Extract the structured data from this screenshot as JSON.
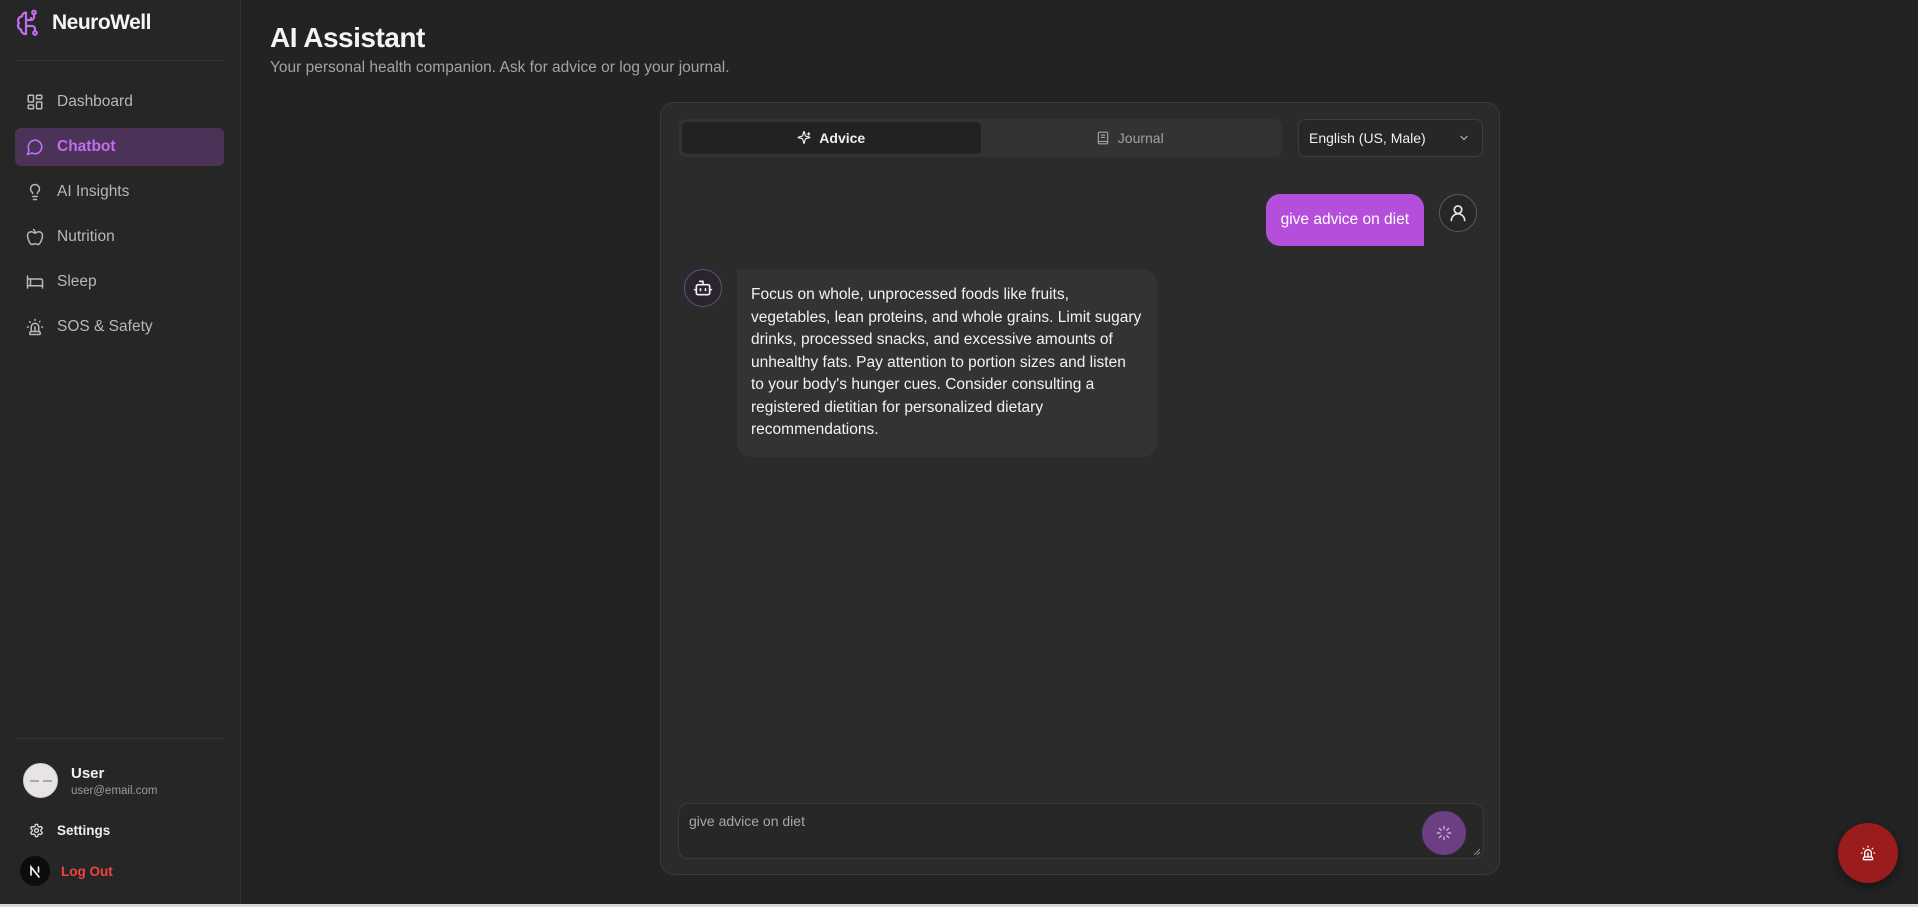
{
  "brand": {
    "name": "NeuroWell",
    "accent": "#c46cf0"
  },
  "sidebar": {
    "items": [
      {
        "label": "Dashboard",
        "icon": "dashboard-grid-icon",
        "active": false
      },
      {
        "label": "Chatbot",
        "icon": "chat-bubble-icon",
        "active": true
      },
      {
        "label": "AI Insights",
        "icon": "lightbulb-icon",
        "active": false
      },
      {
        "label": "Nutrition",
        "icon": "apple-icon",
        "active": false
      },
      {
        "label": "Sleep",
        "icon": "bed-icon",
        "active": false
      },
      {
        "label": "SOS & Safety",
        "icon": "siren-icon",
        "active": false
      }
    ],
    "user": {
      "name": "User",
      "email": "user@email.com"
    },
    "settings_label": "Settings",
    "logout_label": "Log Out"
  },
  "header": {
    "title": "AI Assistant",
    "subtitle": "Your personal health companion. Ask for advice or log your journal."
  },
  "chat": {
    "tabs": [
      {
        "label": "Advice",
        "active": true
      },
      {
        "label": "Journal",
        "active": false
      }
    ],
    "language": "English (US, Male)",
    "messages": [
      {
        "role": "user",
        "text": "give advice on diet"
      },
      {
        "role": "bot",
        "text": "Focus on whole, unprocessed foods like fruits, vegetables, lean proteins, and whole grains. Limit sugary drinks, processed snacks, and excessive amounts of unhealthy fats. Pay attention to portion sizes and listen to your body's hunger cues. Consider consulting a registered dietitian for personalized dietary recommendations."
      }
    ],
    "input": {
      "value": "",
      "placeholder": "give advice on diet"
    }
  },
  "colors": {
    "user_bubble": "#b54fdb",
    "sos": "#9b1c1c",
    "logout": "#ef4444"
  }
}
